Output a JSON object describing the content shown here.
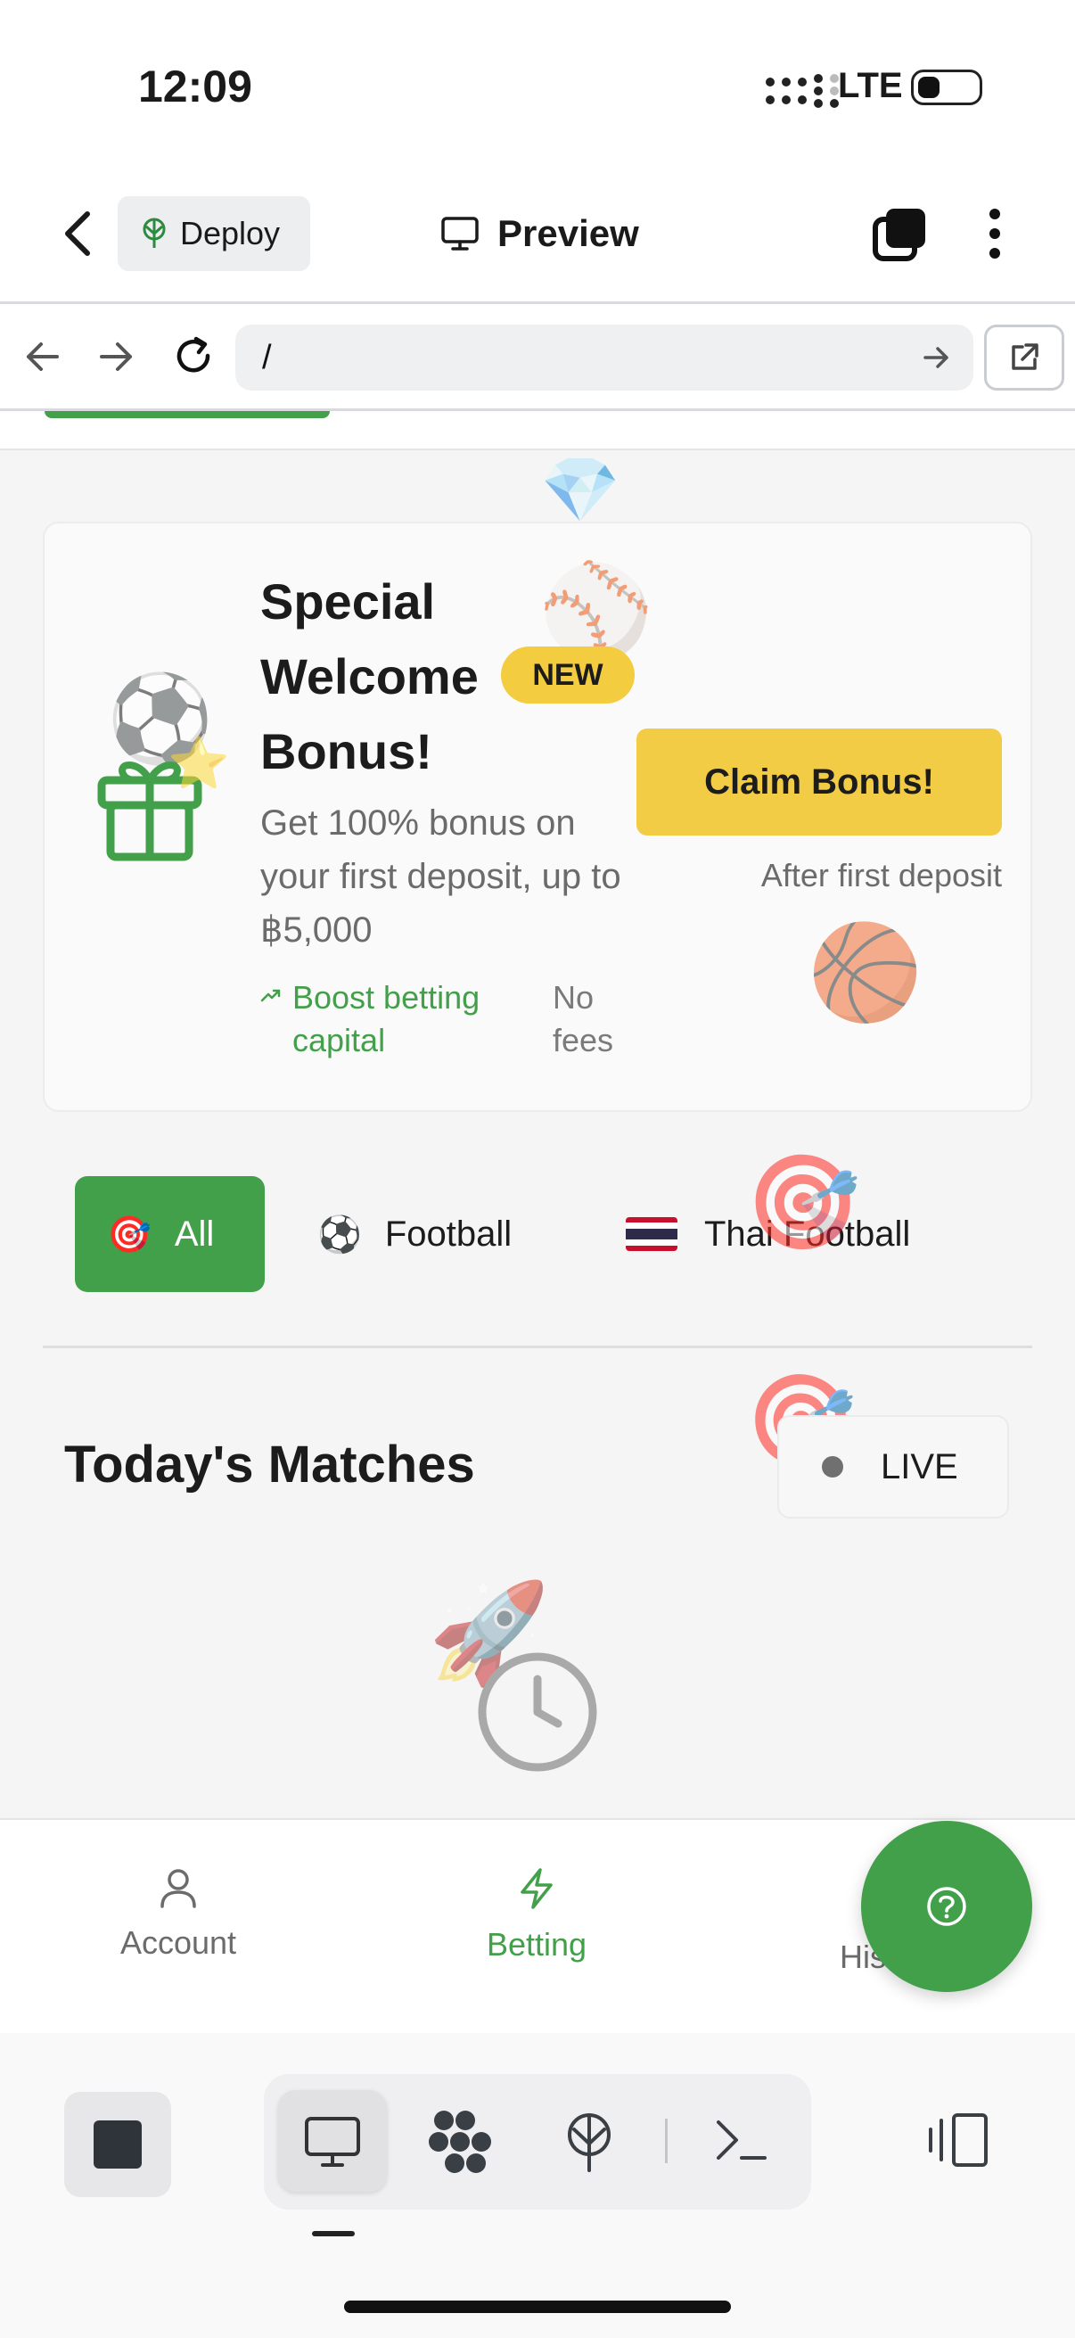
{
  "status_bar": {
    "time": "12:09",
    "network": "LTE"
  },
  "app_header": {
    "deploy_label": "Deploy",
    "preview_label": "Preview"
  },
  "browser": {
    "url": "/"
  },
  "bonus": {
    "title": "Special Welcome Bonus!",
    "badge": "NEW",
    "description": "Get 100% bonus on your first deposit, up to ฿5,000",
    "feature_1": "Boost betting capital",
    "feature_2": "No fees",
    "claim_label": "Claim Bonus!",
    "claim_note": "After first deposit"
  },
  "categories": {
    "all": {
      "emoji": "🎯",
      "label": "All"
    },
    "football": {
      "emoji": "⚽",
      "label": "Football"
    },
    "thai": {
      "label": "Thai Football"
    }
  },
  "matches": {
    "title": "Today's Matches",
    "live_label": "LIVE"
  },
  "bottom_nav": {
    "account": "Account",
    "betting": "Betting",
    "history": "His"
  },
  "decor_emojis": {
    "diamond": "💎",
    "baseball": "⚾",
    "soccer": "⚽",
    "star": "⭐",
    "basketball": "🏀",
    "target": "🎯",
    "rocket": "🚀"
  },
  "colors": {
    "accent_green": "#43a04a",
    "claim_yellow": "#f3cc46",
    "badge_yellow": "#f3cc3f"
  }
}
